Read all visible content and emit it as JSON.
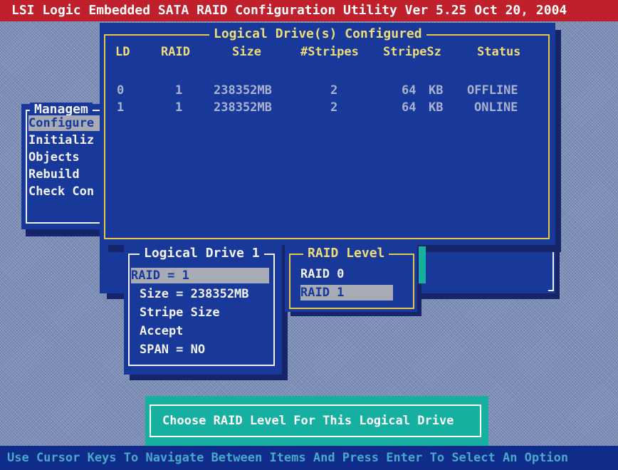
{
  "title_bar": "LSI Logic Embedded SATA RAID Configuration Utility Ver 5.25 Oct 20, 2004",
  "management_menu": {
    "title": "Managem",
    "items": [
      "Configure",
      "Initializ",
      "Objects",
      "Rebuild",
      "Check Con"
    ]
  },
  "configured_dialog": {
    "title": "Logical Drive(s) Configured",
    "headers": [
      "LD",
      "RAID",
      "Size",
      "#Stripes",
      "StripeSz",
      "Status"
    ],
    "rows": [
      {
        "ld": "0",
        "raid": "1",
        "size": "238352MB",
        "stripes": "2",
        "stripe_sz": "64",
        "unit": "KB",
        "status": "OFFLINE"
      },
      {
        "ld": "1",
        "raid": "1",
        "size": "238352MB",
        "stripes": "2",
        "stripe_sz": "64",
        "unit": "KB",
        "status": "ONLINE"
      }
    ]
  },
  "logical_drive_menu": {
    "title": "Logical Drive 1",
    "items": [
      "RAID = 1",
      "Size = 238352MB",
      "Stripe Size",
      "Accept",
      "SPAN = NO"
    ],
    "selected_index": 0
  },
  "raid_level_menu": {
    "title": "RAID Level",
    "items": [
      "RAID 0",
      "RAID 1"
    ],
    "selected_index": 1
  },
  "hint_box": "Choose RAID Level For This Logical Drive",
  "status_bar": "Use Cursor Keys To Navigate Between Items And Press Enter To Select An Option",
  "colors": {
    "title_bar": "#c0202c",
    "panel": "#18389a",
    "frame_yellow": "#e6c64a",
    "highlight": "#a7abb6",
    "teal": "#16b0a0"
  }
}
